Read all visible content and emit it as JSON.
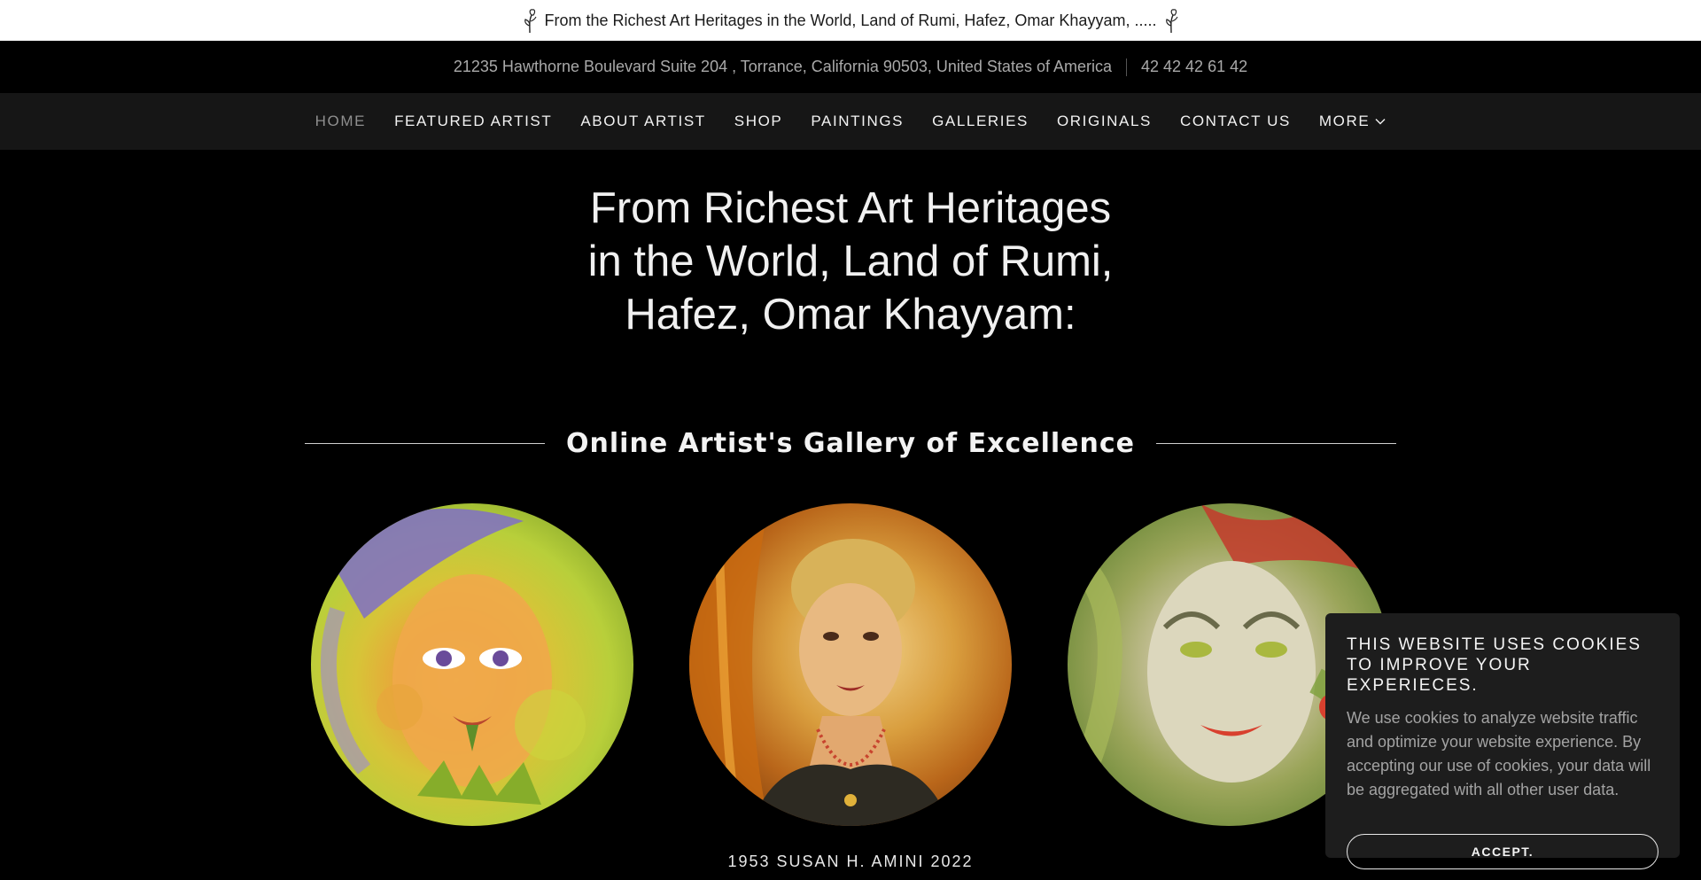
{
  "announcement": {
    "text": "From the Richest Art Heritages in the World, Land of Rumi, Hafez, Omar Khayyam, .....",
    "icon_left": "flower-icon",
    "icon_right": "flower-icon"
  },
  "infobar": {
    "address": "21235 Hawthorne Boulevard Suite 204 , Torrance, California 90503, United States of America",
    "phone": "42 42 42 61 42"
  },
  "nav": {
    "items": [
      {
        "label": "HOME",
        "active": true
      },
      {
        "label": "FEATURED ARTIST"
      },
      {
        "label": "ABOUT ARTIST"
      },
      {
        "label": "SHOP"
      },
      {
        "label": "PAINTINGS"
      },
      {
        "label": "GALLERIES"
      },
      {
        "label": "ORIGINALS"
      },
      {
        "label": "CONTACT US"
      },
      {
        "label": "MORE"
      }
    ]
  },
  "hero": {
    "title_lines": [
      "From Richest Art Heritages",
      "in the World, Land of Rumi,",
      "Hafez, Omar Khayyam:"
    ]
  },
  "section": {
    "heading": "Online Artist's Gallery of Excellence"
  },
  "gallery": {
    "caption": "1953 SUSAN H. AMINI 2022"
  },
  "cookie": {
    "title": "THIS WEBSITE USES COOKIES TO IMPROVE YOUR EXPERIECES.",
    "body": "We use cookies to analyze website traffic and optimize your website experience. By accepting our use of cookies, your data will be aggregated with all other user data.",
    "accept_label": "ACCEPT."
  },
  "colors": {
    "background": "#000000",
    "nav_background": "#161616",
    "announcement_background": "#ffffff",
    "cookie_background": "#1d1d1d",
    "muted_text": "#a9a9a9"
  }
}
